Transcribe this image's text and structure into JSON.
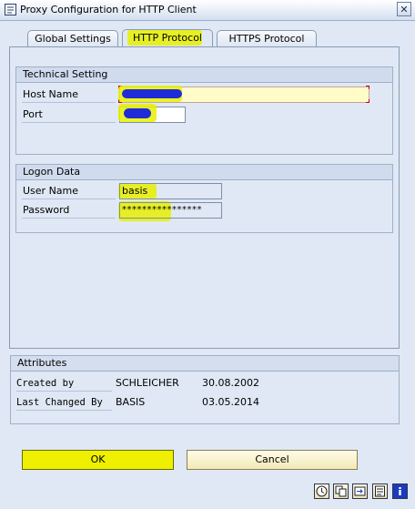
{
  "window": {
    "title": "Proxy Configuration for HTTP Client",
    "close_label": "✕"
  },
  "tabs": [
    {
      "label": "Global Settings"
    },
    {
      "label": "HTTP Protocol"
    },
    {
      "label": "HTTPS Protocol"
    }
  ],
  "technical": {
    "title": "Technical Setting",
    "host_label": "Host Name",
    "host_value": "",
    "port_label": "Port",
    "port_value": ""
  },
  "logon": {
    "title": "Logon Data",
    "user_label": "User Name",
    "user_value": "basis",
    "password_label": "Password",
    "password_value": "****************"
  },
  "attributes": {
    "title": "Attributes",
    "created_label": "Created by",
    "created_by": "SCHLEICHER",
    "created_date": "30.08.2002",
    "changed_label": "Last Changed By",
    "changed_by": "BASIS",
    "changed_date": "03.05.2014"
  },
  "buttons": {
    "ok": "OK",
    "cancel": "Cancel"
  },
  "toolbar": {
    "icons": [
      "help-icon",
      "copy-icon",
      "navigate-icon",
      "notes-icon",
      "info-icon"
    ]
  },
  "colors": {
    "highlight": "#e8f000",
    "scribble": "#1f2bd8",
    "window_bg": "#dfe8f4"
  }
}
